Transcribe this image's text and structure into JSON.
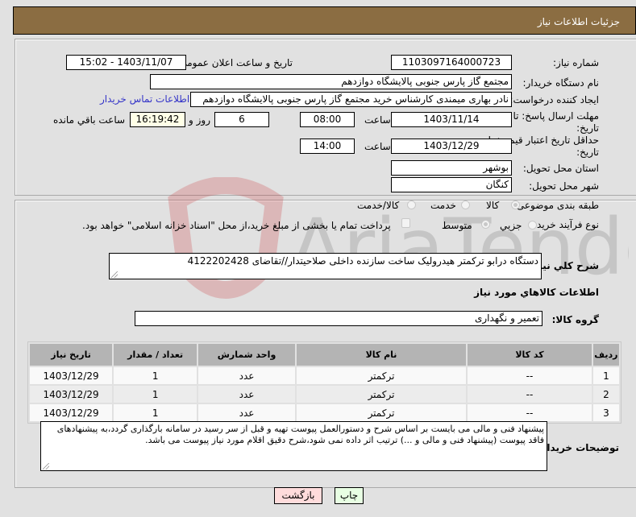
{
  "header": {
    "title": "جزئیات اطلاعات نیاز"
  },
  "form": {
    "need_number": {
      "label": "شماره نیاز:",
      "value": "1103097164000723"
    },
    "announce_datetime": {
      "label": "تاریخ و ساعت اعلان عمومي:",
      "value": "1403/11/07 - 15:02"
    },
    "buyer_org": {
      "label": "نام دستگاه خریدار:",
      "value": "مجتمع گاز پارس جنوبی  پالایشگاه دوازدهم"
    },
    "requester": {
      "label": "ایجاد کننده درخواست:",
      "value": "نادر بهاری میمندی کارشناس خرید مجتمع گاز پارس جنوبی  پالایشگاه دوازدهم",
      "contact_link": "اطلاعات تماس خریدار"
    },
    "reply_deadline": {
      "label": "مهلت ارسال پاسخ: تا تاریخ:",
      "date": "1403/11/14",
      "time_label": "ساعت",
      "time": "08:00",
      "days": "6",
      "days_label": "روز و",
      "remaining": "16:19:42",
      "remaining_label": "ساعت باقي مانده"
    },
    "price_validity": {
      "label": "حداقل تاریخ اعتبار قیمت: تا تاریخ:",
      "date": "1403/12/29",
      "time_label": "ساعت",
      "time": "14:00"
    },
    "delivery_province": {
      "label": "استان محل تحویل:",
      "value": "بوشهر"
    },
    "delivery_city": {
      "label": "شهر محل تحویل:",
      "value": "کنگان"
    },
    "category": {
      "label": "طبقه بندی موضوعی:",
      "options": [
        "کالا",
        "خدمت",
        "کالا/خدمت"
      ],
      "selected": "کالا"
    },
    "purchase_type": {
      "label": "نوع فرآیند خرید :",
      "options": [
        "جزيي",
        "متوسط"
      ],
      "selected": "متوسط",
      "treasury_note": "پرداخت تمام یا بخشی از مبلغ خرید،از محل \"اسناد خزانه اسلامی\" خواهد بود."
    }
  },
  "details": {
    "description_label": "شرح کلي نياز:",
    "description": "دستگاه درابو ترکمتر هیدرولیک ساخت سازنده داخلی صلاحیتدار//تقاضای 4122202428",
    "goods_section_title": "اطلاعات کالاهاي مورد نياز",
    "goods_group_label": "گروه کالا:",
    "goods_group": "تعمیر و نگهداری",
    "table": {
      "headers": [
        "ردیف",
        "کد کالا",
        "نام کالا",
        "واحد شمارش",
        "تعداد / مقدار",
        "تاریخ نیاز"
      ],
      "rows": [
        [
          "1",
          "--",
          "ترکمتر",
          "عدد",
          "1",
          "1403/12/29"
        ],
        [
          "2",
          "--",
          "ترکمتر",
          "عدد",
          "1",
          "1403/12/29"
        ],
        [
          "3",
          "--",
          "ترکمتر",
          "عدد",
          "1",
          "1403/12/29"
        ]
      ]
    },
    "buyer_notes_label": "توضیحات خریدار:",
    "buyer_notes": "پیشنهاد فنی و مالی می بایست بر اساس شرح و دستورالعمل پیوست تهیه و قبل از سر رسید در سامانه بارگذاری گردد،به پیشنهادهای فاقد پیوست (پیشنهاد فنی و مالی و ...) ترتیب اثر داده نمی شود،شرح دقیق اقلام مورد نیاز پیوست می باشد."
  },
  "buttons": {
    "print": "چاپ",
    "back": "بازگشت"
  },
  "watermark": {
    "text": "AriaTender.net",
    "colors": {
      "logo": "#c8282d",
      "text": "#646464"
    }
  }
}
